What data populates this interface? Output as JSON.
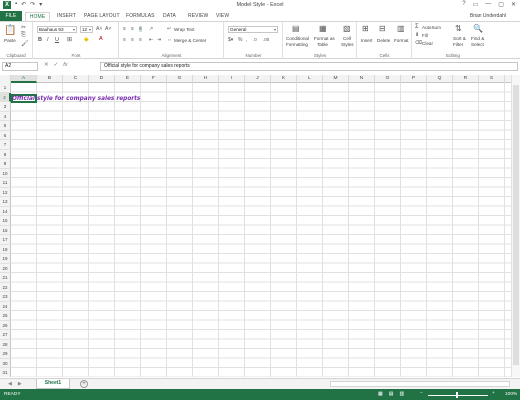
{
  "window": {
    "title": "Model Style - Excel",
    "user": "Brian Underdahl",
    "controls": [
      "?",
      "▭",
      "—",
      "▢",
      "✕"
    ]
  },
  "tabs": [
    {
      "label": "FILE"
    },
    {
      "label": "HOME"
    },
    {
      "label": "INSERT"
    },
    {
      "label": "PAGE LAYOUT"
    },
    {
      "label": "FORMULAS"
    },
    {
      "label": "DATA"
    },
    {
      "label": "REVIEW"
    },
    {
      "label": "VIEW"
    }
  ],
  "ribbon": {
    "clipboard": {
      "label": "Clipboard",
      "paste": "Paste"
    },
    "font": {
      "label": "Font",
      "font_name": "Bauhaus 93",
      "font_size": "12"
    },
    "alignment": {
      "label": "Alignment",
      "wrap_text": "Wrap Text",
      "merge_center": "Merge & Center"
    },
    "number": {
      "label": "Number",
      "format": "General"
    },
    "styles": {
      "label": "Styles",
      "conditional": "Conditional",
      "conditional2": "Formatting",
      "format_as": "Format as",
      "format_as2": "Table",
      "cell": "Cell",
      "cell2": "Styles"
    },
    "cells": {
      "label": "Cells",
      "insert": "Insert",
      "delete": "Delete",
      "format": "Format"
    },
    "editing": {
      "label": "Editing",
      "autosum": "AutoSum",
      "fill": "Fill",
      "clear": "Clear",
      "sort": "Sort &",
      "sort2": "Filter",
      "find": "Find &",
      "find2": "Select"
    }
  },
  "formula_bar": {
    "name_box": "A2",
    "content": "Official style for company sales reports"
  },
  "grid": {
    "columns": [
      "A",
      "B",
      "C",
      "D",
      "E",
      "F",
      "G",
      "H",
      "I",
      "J",
      "K",
      "L",
      "M",
      "N",
      "O",
      "P",
      "Q",
      "R",
      "S"
    ],
    "active_column": "A",
    "active_row": 2,
    "row_count": 31,
    "cell_A2": "Official style for company sales reports",
    "cell_color": "#7a2cb0"
  },
  "sheets": {
    "tabs": [
      "Sheet1"
    ],
    "add": "+"
  },
  "status": {
    "ready": "READY",
    "zoom": "100%",
    "zoom_out": "−",
    "zoom_in": "+"
  },
  "colors": {
    "accent": "#217346"
  }
}
